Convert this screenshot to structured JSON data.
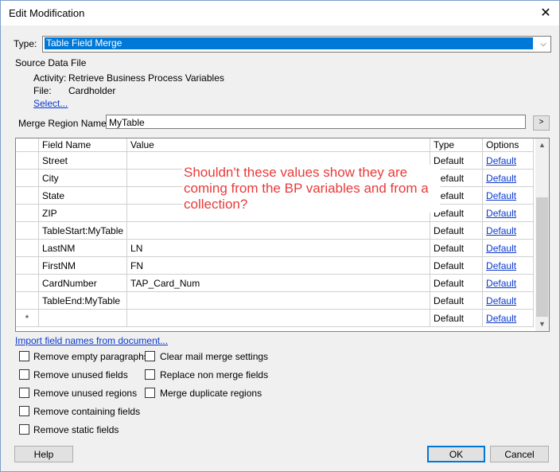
{
  "window": {
    "title": "Edit Modification"
  },
  "type_label": "Type:",
  "type_value": "Table Field Merge",
  "source": {
    "heading": "Source Data File",
    "activity_label": "Activity:",
    "activity_value": "Retrieve Business Process Variables",
    "file_label": "File:",
    "file_value": "Cardholder",
    "select_link": "Select..."
  },
  "merge_region": {
    "label": "Merge Region Name:",
    "value": "MyTable",
    "button": ">"
  },
  "grid": {
    "headers": [
      "Field Name",
      "Value",
      "Type",
      "Options"
    ],
    "rows": [
      {
        "field": "Street",
        "value": "",
        "type": "Default",
        "option": "Default"
      },
      {
        "field": "City",
        "value": "",
        "type": "Default",
        "option": "Default"
      },
      {
        "field": "State",
        "value": "",
        "type": "Default",
        "option": "Default"
      },
      {
        "field": "ZIP",
        "value": "",
        "type": "Default",
        "option": "Default"
      },
      {
        "field": "TableStart:MyTable",
        "value": "",
        "type": "Default",
        "option": "Default"
      },
      {
        "field": "LastNM",
        "value": "LN",
        "type": "Default",
        "option": "Default"
      },
      {
        "field": "FirstNM",
        "value": "FN",
        "type": "Default",
        "option": "Default"
      },
      {
        "field": "CardNumber",
        "value": "TAP_Card_Num",
        "type": "Default",
        "option": "Default"
      },
      {
        "field": "TableEnd:MyTable",
        "value": "",
        "type": "Default",
        "option": "Default"
      },
      {
        "marker": "*",
        "field": "",
        "value": "",
        "type": "Default",
        "option": "Default"
      }
    ]
  },
  "annotation": "Shouldn't these values show they are coming from the BP variables and from a collection?",
  "import_link": "Import field names from document...",
  "options": {
    "remove_empty_paragraphs": "Remove empty paragraphs",
    "remove_unused_fields": "Remove unused fields",
    "remove_unused_regions": "Remove unused regions",
    "remove_containing_fields": "Remove containing fields",
    "remove_static_fields": "Remove static fields",
    "clear_mail_merge_settings": "Clear mail merge settings",
    "replace_non_merge_fields": "Replace non merge fields",
    "merge_duplicate_regions": "Merge duplicate regions"
  },
  "buttons": {
    "help": "Help",
    "ok": "OK",
    "cancel": "Cancel"
  }
}
